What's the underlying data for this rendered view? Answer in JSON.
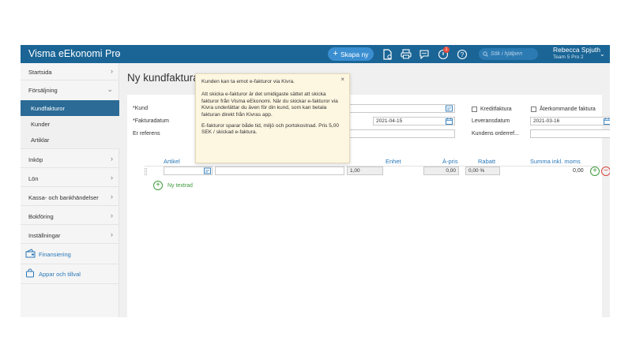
{
  "app": {
    "title": "Visma eEkonomi Pro",
    "create_button": "Skapa ny",
    "search_placeholder": "Sök i hjälpen",
    "notification_count": "1",
    "user_name": "Rebecca Spjuth",
    "user_team": "Team 5 Pro 2"
  },
  "sidebar": {
    "items": [
      {
        "label": "Startsida"
      },
      {
        "label": "Försäljning"
      },
      {
        "label": "Inköp"
      },
      {
        "label": "Lön"
      },
      {
        "label": "Kassa- och bankhändelser"
      },
      {
        "label": "Bokföring"
      },
      {
        "label": "Inställningar"
      }
    ],
    "sub_items": [
      {
        "label": "Kundfakturor"
      },
      {
        "label": "Kunder"
      },
      {
        "label": "Artiklar"
      }
    ],
    "links": [
      {
        "label": "Finansiering"
      },
      {
        "label": "Appar och tillval"
      }
    ]
  },
  "page": {
    "title": "Ny kundfaktura"
  },
  "form": {
    "kund_label": "Kund",
    "fakturadatum_label": "Fakturadatum",
    "referens_label": "Er referens",
    "due_date": "2021-04-15",
    "kreditfaktura_label": "Kreditfaktura",
    "aterkommande_label": "Återkommande faktura",
    "leveransdatum_label": "Leveransdatum",
    "leveransdatum_value": "2021-03-16",
    "orderref_label": "Kundens orderref..."
  },
  "rows": {
    "headers": {
      "artikel": "Artikel",
      "enhet": "Enhet",
      "apris": "À-pris",
      "rabatt": "Rabatt",
      "summa": "Summa inkl. moms"
    },
    "row1": {
      "antal": "1,00",
      "apris": "0,00",
      "rabatt": "0,00 %",
      "summa": "0,00"
    },
    "add_row_label": "Ny textrad"
  },
  "tooltip": {
    "heading": "Kunden kan ta emot e-fakturor via Kivra.",
    "paragraph1": "Att skicka e-fakturor är det smidigaste sättet att skicka fakturor från Visma eEkonomi. När du skickar e-fakturor via Kivra underlättar du även för din kund, som kan betala fakturan direkt från Kivras app.",
    "paragraph2": "E-fakturor sparar både tid, miljö och portokostnad. Pris 5,00 SEK / skickad e-faktura.",
    "close": "×"
  },
  "colors": {
    "topbar": "#1a6596",
    "accent": "#2a78b8",
    "active_nav": "#2b6b96",
    "add_green": "#3f9a3f",
    "remove_red": "#d9453d",
    "tooltip_bg": "#fdf6e1"
  }
}
